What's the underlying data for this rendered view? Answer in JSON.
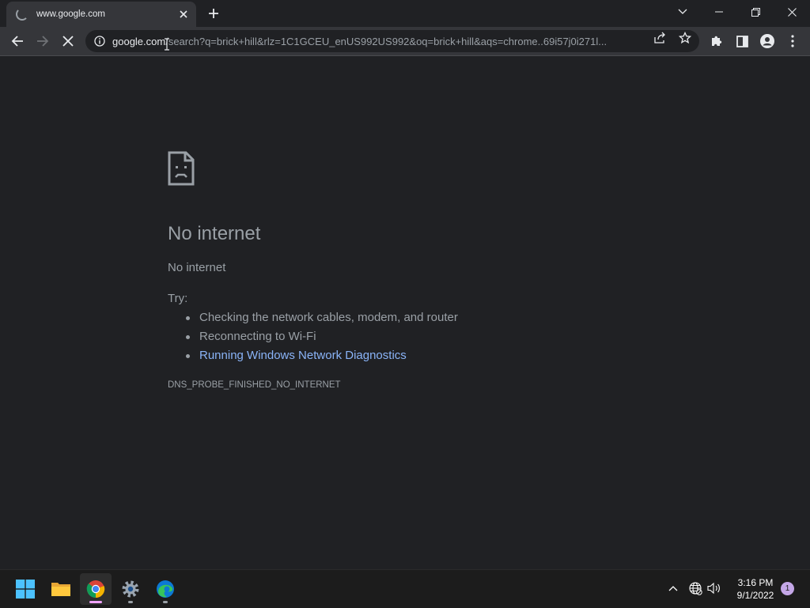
{
  "browser": {
    "tab": {
      "title": "www.google.com",
      "loading": true
    },
    "address_bar": {
      "host": "google.com",
      "path": "/search?q=brick+hill&rlz=1C1GCEU_enUS992US992&oq=brick+hill&aqs=chrome..69i57j0i271l..."
    }
  },
  "error_page": {
    "heading": "No internet",
    "message": "No internet",
    "try_label": "Try:",
    "suggestions": [
      {
        "text": "Checking the network cables, modem, and router",
        "link": false
      },
      {
        "text": "Reconnecting to Wi-Fi",
        "link": false
      },
      {
        "text": "Running Windows Network Diagnostics",
        "link": true
      }
    ],
    "error_code": "DNS_PROBE_FINISHED_NO_INTERNET"
  },
  "taskbar": {
    "apps": [
      "start-icon",
      "file-explorer-icon",
      "chrome-icon",
      "settings-icon",
      "edge-icon"
    ],
    "clock": {
      "time": "3:16 PM",
      "date": "9/1/2022"
    },
    "notification_count": "1"
  },
  "colors": {
    "background": "#202124",
    "toolbar": "#35363a",
    "link": "#8ab4f8",
    "text_muted": "#9aa0a6",
    "chrome_indicator": "#f0a3ff"
  }
}
